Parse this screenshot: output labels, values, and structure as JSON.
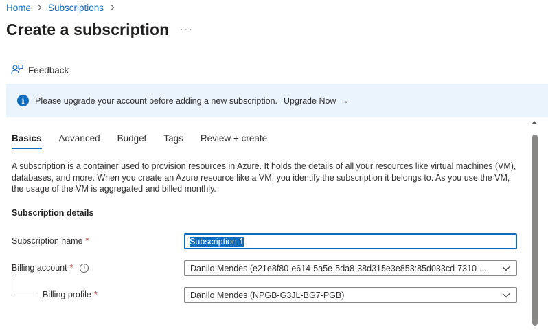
{
  "breadcrumb": {
    "items": [
      "Home",
      "Subscriptions"
    ]
  },
  "page": {
    "title": "Create a subscription",
    "more": "···"
  },
  "toolbar": {
    "feedback_label": "Feedback",
    "feedback_icon": "feedback-person-icon"
  },
  "banner": {
    "icon": "info-icon",
    "message": "Please upgrade your account before adding a new subscription.",
    "link_label": "Upgrade Now",
    "link_arrow": "→",
    "background": "#ebf3fc"
  },
  "tabs": [
    {
      "label": "Basics",
      "active": true
    },
    {
      "label": "Advanced",
      "active": false
    },
    {
      "label": "Budget",
      "active": false
    },
    {
      "label": "Tags",
      "active": false
    },
    {
      "label": "Review + create",
      "active": false
    }
  ],
  "description": "A subscription is a container used to provision resources in Azure. It holds the details of all your resources like virtual machines (VM), databases, and more. When you create an Azure resource like a VM, you identify the subscription it belongs to. As you use the VM, the usage of the VM is aggregated and billed monthly.",
  "section": {
    "title": "Subscription details"
  },
  "form": {
    "subscription_name": {
      "label": "Subscription name",
      "required_mark": "*",
      "value": "Subscription 1"
    },
    "billing_account": {
      "label": "Billing account",
      "required_mark": "*",
      "help": "i",
      "value": "Danilo Mendes (e21e8f80-e614-5a5e-5da8-38d315e3e853:85d033cd-7310-..."
    },
    "billing_profile": {
      "label": "Billing profile",
      "required_mark": "*",
      "value": "Danilo Mendes (NPGB-G3JL-BG7-PGB)"
    }
  },
  "colors": {
    "accent": "#0f6cbd",
    "required": "#a4262c",
    "text": "#323130"
  }
}
